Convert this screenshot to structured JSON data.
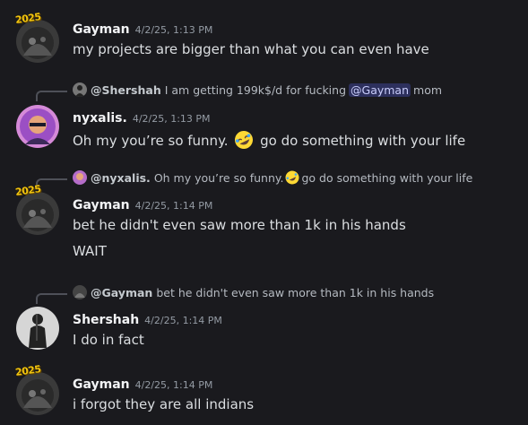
{
  "messages": [
    {
      "username": "Gayman",
      "timestamp": "4/2/25, 1:13 PM",
      "badge": "2025",
      "content": "my projects are bigger than what you can even have"
    },
    {
      "reply": {
        "name": "@Shershah",
        "text_before": "I am getting 199k$/d for fucking",
        "mention": "@Gayman",
        "text_after": "mom"
      },
      "username": "nyxalis.",
      "timestamp": "4/2/25, 1:13 PM",
      "content_before": "Oh my you’re so funny.",
      "content_after": "go do something with your life",
      "emoji": "rofl-emoji"
    },
    {
      "reply": {
        "name": "@nyxalis.",
        "text_before": "Oh my you’re so funny.",
        "text_after": "go do something with your life"
      },
      "username": "Gayman",
      "timestamp": "4/2/25, 1:14 PM",
      "badge": "2025",
      "lines": [
        "bet he didn't even saw more than 1k in his hands",
        "WAIT"
      ]
    },
    {
      "reply": {
        "name": "@Gayman",
        "text": "bet he didn't even saw more than 1k in his hands"
      },
      "username": "Shershah",
      "timestamp": "4/2/25, 1:14 PM",
      "content": "I do in fact"
    },
    {
      "username": "Gayman",
      "timestamp": "4/2/25, 1:14 PM",
      "badge": "2025",
      "content": "i forgot they are all indians"
    }
  ],
  "colors": {
    "background": "#1a1a1e",
    "username": "#f2f3f5",
    "text": "#dbdee1",
    "muted": "#949ba4",
    "mention_bg": "#3b3f75",
    "mention_text": "#c9cdfb"
  }
}
